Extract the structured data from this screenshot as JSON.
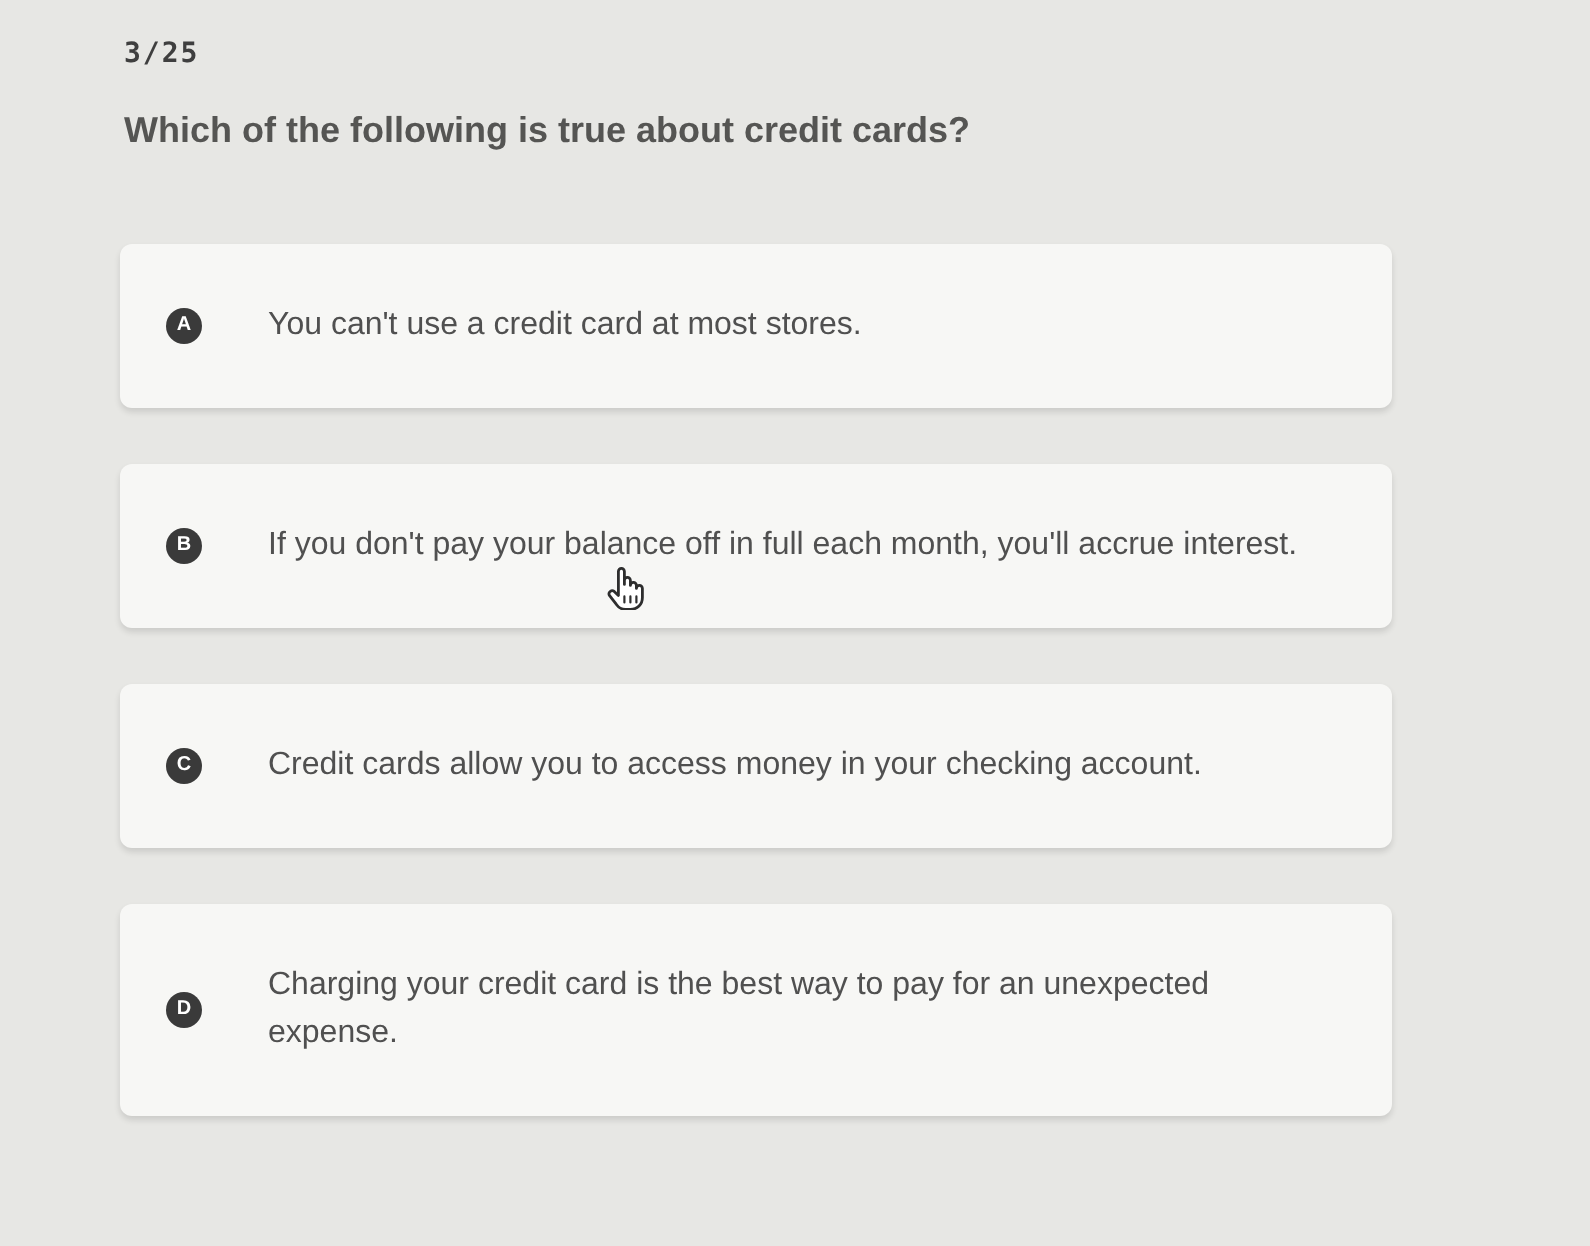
{
  "progress": "3/25",
  "question": "Which of the following is true about credit cards?",
  "options": [
    {
      "letter": "A",
      "text": "You can't use a credit card at most stores.",
      "selected": false
    },
    {
      "letter": "B",
      "text": "If you don't pay your balance off in full each month, you'll accrue interest.",
      "selected": false
    },
    {
      "letter": "C",
      "text": "Credit cards allow you to access money in your checking account.",
      "selected": false
    },
    {
      "letter": "D",
      "text": "Charging your credit card is the best way to pay for an unexpected expense.",
      "selected": false
    }
  ]
}
